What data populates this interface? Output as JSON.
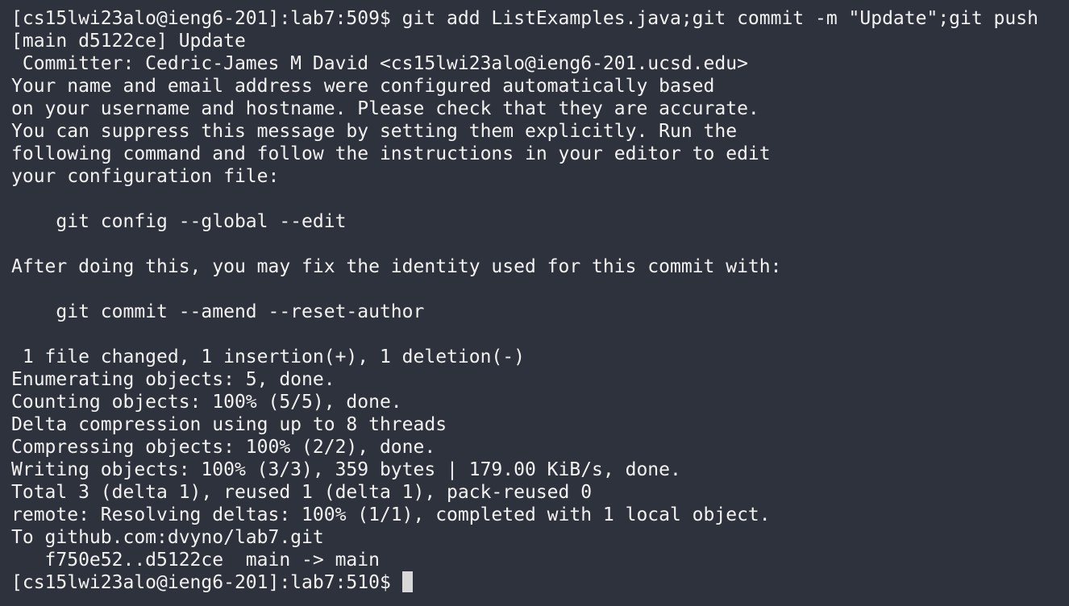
{
  "terminal": {
    "lines": [
      "[cs15lwi23alo@ieng6-201]:lab7:509$ git add ListExamples.java;git commit -m \"Update\";git push",
      "[main d5122ce] Update",
      " Committer: Cedric-James M David <cs15lwi23alo@ieng6-201.ucsd.edu>",
      "Your name and email address were configured automatically based",
      "on your username and hostname. Please check that they are accurate.",
      "You can suppress this message by setting them explicitly. Run the",
      "following command and follow the instructions in your editor to edit",
      "your configuration file:",
      "",
      "    git config --global --edit",
      "",
      "After doing this, you may fix the identity used for this commit with:",
      "",
      "    git commit --amend --reset-author",
      "",
      " 1 file changed, 1 insertion(+), 1 deletion(-)",
      "Enumerating objects: 5, done.",
      "Counting objects: 100% (5/5), done.",
      "Delta compression using up to 8 threads",
      "Compressing objects: 100% (2/2), done.",
      "Writing objects: 100% (3/3), 359 bytes | 179.00 KiB/s, done.",
      "Total 3 (delta 1), reused 1 (delta 1), pack-reused 0",
      "remote: Resolving deltas: 100% (1/1), completed with 1 local object.",
      "To github.com:dvyno/lab7.git",
      "   f750e52..d5122ce  main -> main"
    ],
    "prompt": "[cs15lwi23alo@ieng6-201]:lab7:510$"
  },
  "colors": {
    "background": "#2e323d",
    "text": "#f2f2f2",
    "cursor": "#d8d8d8"
  }
}
